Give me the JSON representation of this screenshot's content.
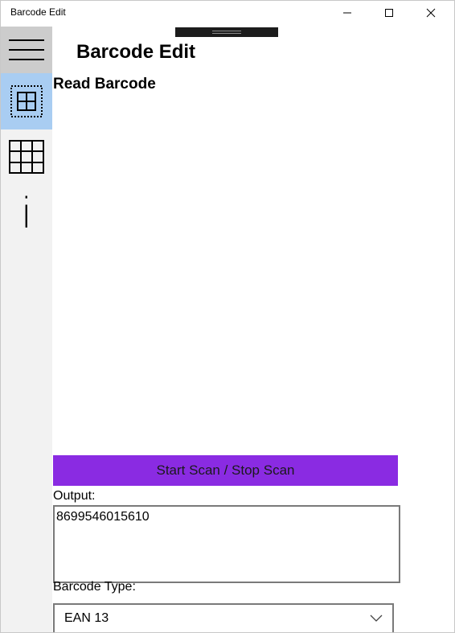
{
  "window": {
    "title": "Barcode Edit"
  },
  "header": {
    "app_title": "Barcode Edit"
  },
  "sidebar": {
    "items": [
      {
        "name": "menu",
        "icon": "hamburger-icon",
        "selected": false
      },
      {
        "name": "read-barcode",
        "icon": "read-barcode-icon",
        "selected": true
      },
      {
        "name": "create-barcode",
        "icon": "grid-icon",
        "selected": false
      },
      {
        "name": "info",
        "icon": "info-icon",
        "label": "i",
        "selected": false
      }
    ]
  },
  "main": {
    "page_title": "Read Barcode",
    "scan_button_label": "Start Scan / Stop Scan",
    "output_label": "Output:",
    "output_value": "8699546015610",
    "barcode_type_label": "Barcode Type:",
    "barcode_type_value": "EAN 13"
  },
  "colors": {
    "accent": "#8a2be2",
    "sidebar_selected": "#a9cdf2",
    "sidebar_bg": "#f2f2f2",
    "hamburger_bg": "#cccccc"
  }
}
